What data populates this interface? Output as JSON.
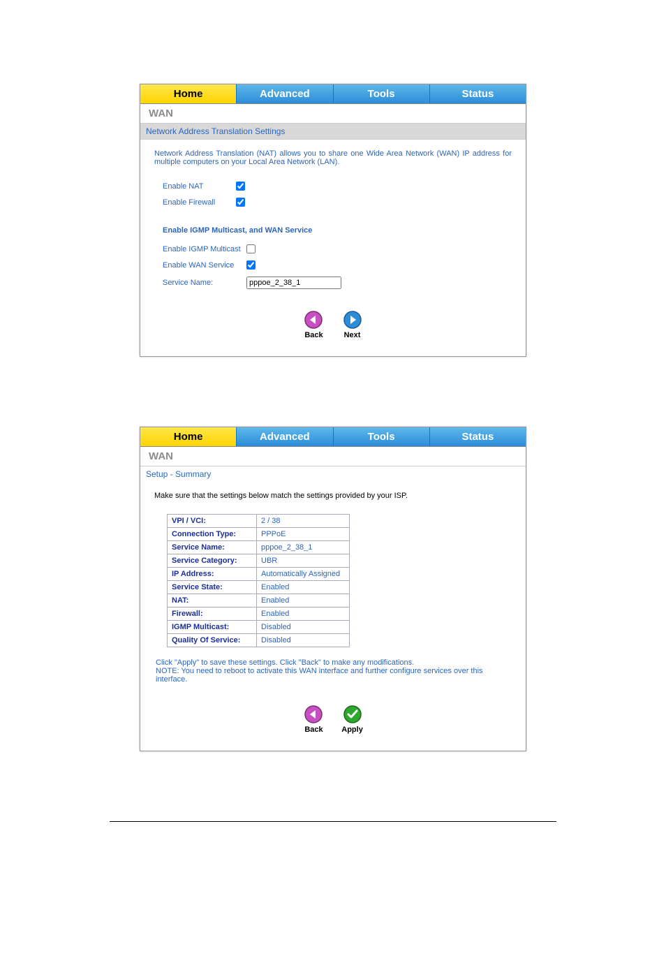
{
  "tabs": {
    "home": "Home",
    "advanced": "Advanced",
    "tools": "Tools",
    "status": "Status"
  },
  "panel1": {
    "section": "WAN",
    "subheader": "Network Address Translation Settings",
    "description": "Network Address Translation (NAT) allows you to share one Wide Area Network (WAN) IP address for multiple computers on your Local Area Network (LAN).",
    "enable_nat_label": "Enable NAT",
    "enable_firewall_label": "Enable Firewall",
    "igmp_section_title": "Enable IGMP Multicast, and WAN Service",
    "enable_igmp_label": "Enable IGMP Multicast",
    "enable_wan_label": "Enable WAN Service",
    "service_name_label": "Service Name:",
    "service_name_value": "pppoe_2_38_1",
    "back_label": "Back",
    "next_label": "Next"
  },
  "panel2": {
    "section": "WAN",
    "subheader": "Setup - Summary",
    "intro": "Make sure that the settings below match the settings provided by your ISP.",
    "rows": [
      {
        "label": "VPI / VCI:",
        "value": "2 / 38"
      },
      {
        "label": "Connection Type:",
        "value": "PPPoE"
      },
      {
        "label": "Service Name:",
        "value": "pppoe_2_38_1"
      },
      {
        "label": "Service Category:",
        "value": "UBR"
      },
      {
        "label": "IP Address:",
        "value": "Automatically Assigned"
      },
      {
        "label": "Service State:",
        "value": "Enabled"
      },
      {
        "label": "NAT:",
        "value": "Enabled"
      },
      {
        "label": "Firewall:",
        "value": "Enabled"
      },
      {
        "label": "IGMP Multicast:",
        "value": "Disabled"
      },
      {
        "label": "Quality Of Service:",
        "value": "Disabled"
      }
    ],
    "note_line1": "Click \"Apply\" to save these settings. Click \"Back\" to make any modifications.",
    "note_line2": "NOTE: You need to reboot to activate this WAN interface and further configure services over this interface.",
    "back_label": "Back",
    "apply_label": "Apply"
  }
}
